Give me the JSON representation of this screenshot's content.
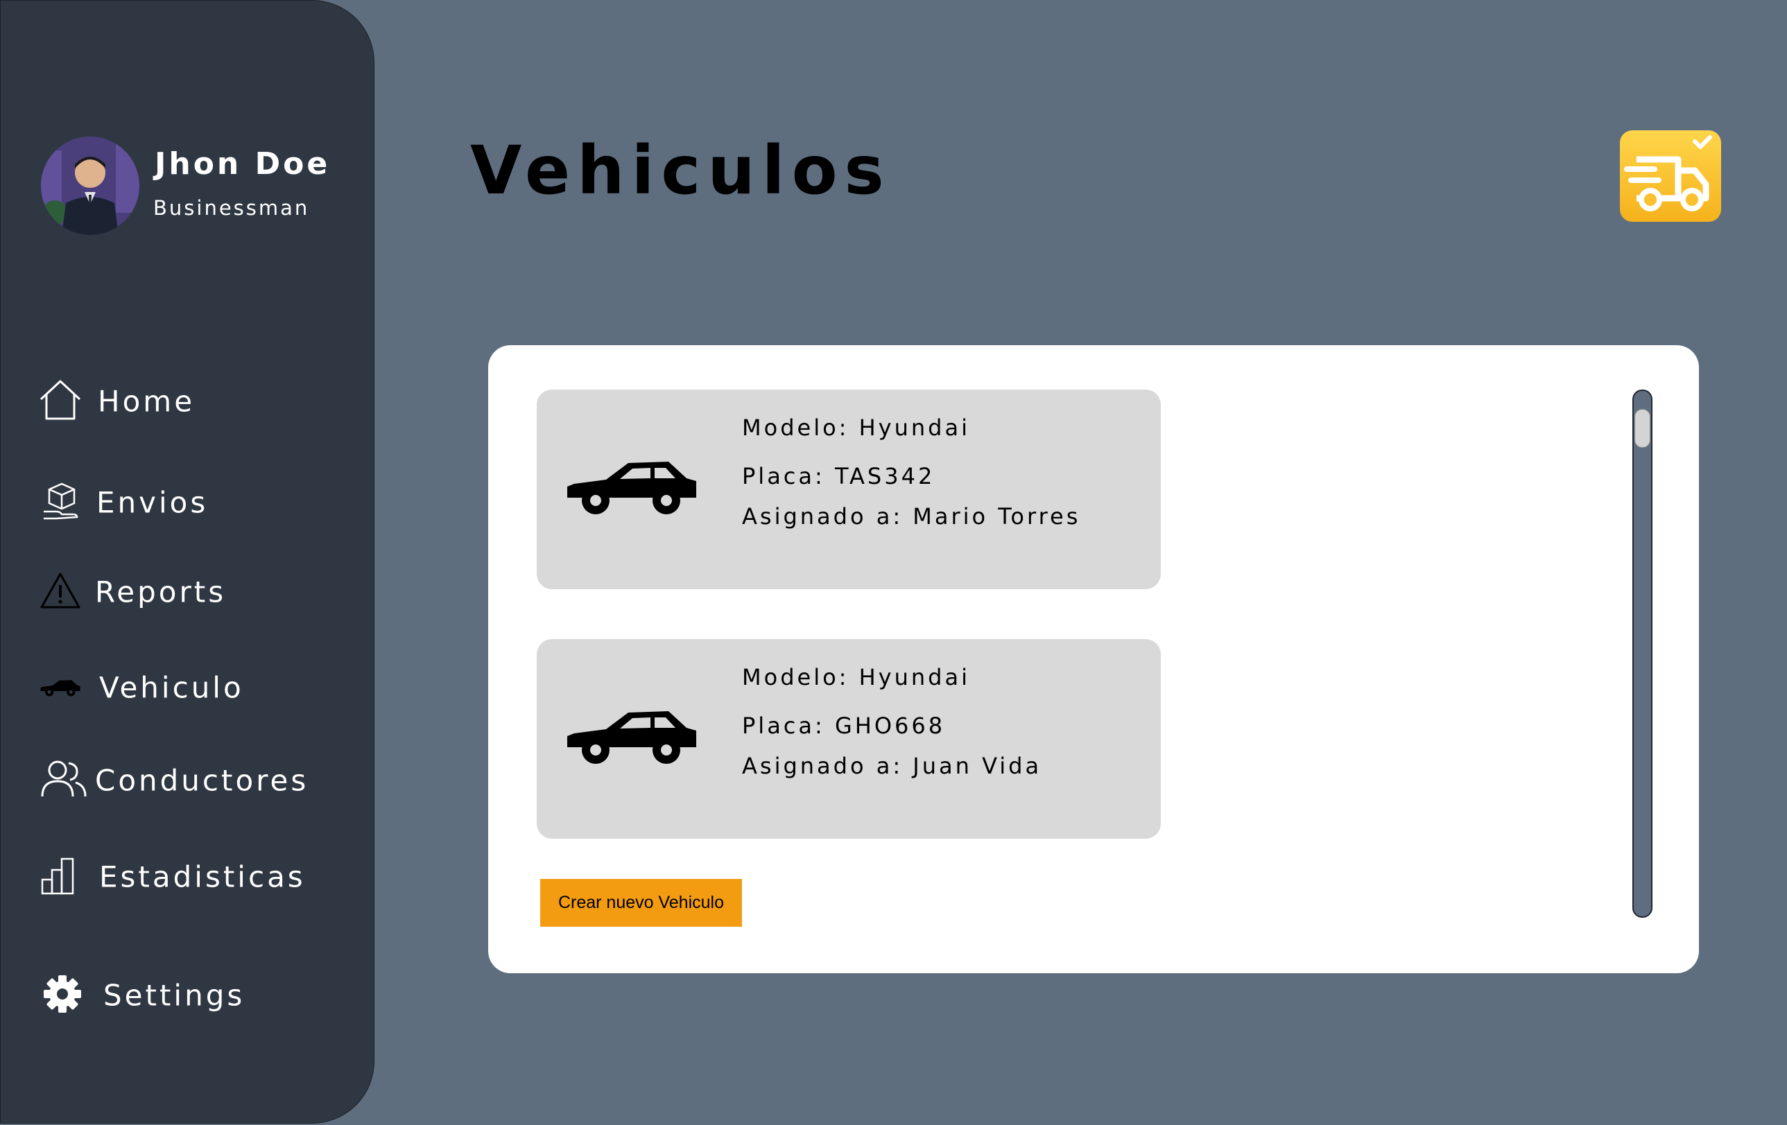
{
  "user": {
    "name": "Jhon Doe",
    "role": "Businessman",
    "avatar_icon": "user-avatar-photo"
  },
  "nav": {
    "items": [
      {
        "label": "Home",
        "icon": "home-icon"
      },
      {
        "label": "Envios",
        "icon": "package-icon"
      },
      {
        "label": "Reports",
        "icon": "warning-icon"
      },
      {
        "label": "Vehiculo",
        "icon": "car-icon"
      },
      {
        "label": "Conductores",
        "icon": "users-icon"
      },
      {
        "label": "Estadisticas",
        "icon": "bar-chart-icon"
      },
      {
        "label": "Settings",
        "icon": "gear-icon"
      }
    ]
  },
  "header": {
    "title": "Vehiculos",
    "logo_icon": "delivery-truck-icon"
  },
  "vehicles": [
    {
      "model": "Modelo: Hyundai",
      "plate": "Placa: TAS342",
      "assigned": "Asignado a: Mario Torres",
      "icon": "car-icon"
    },
    {
      "model": "Modelo: Hyundai",
      "plate": "Placa: GHO668",
      "assigned": "Asignado a: Juan Vida",
      "icon": "car-icon"
    }
  ],
  "actions": {
    "create_label": "Crear nuevo Vehiculo"
  },
  "colors": {
    "background": "#5f6e7f",
    "sidebar": "#2f3742",
    "card": "#d9d9d9",
    "accent_button": "#f39c12",
    "logo": "#fbc02d"
  }
}
